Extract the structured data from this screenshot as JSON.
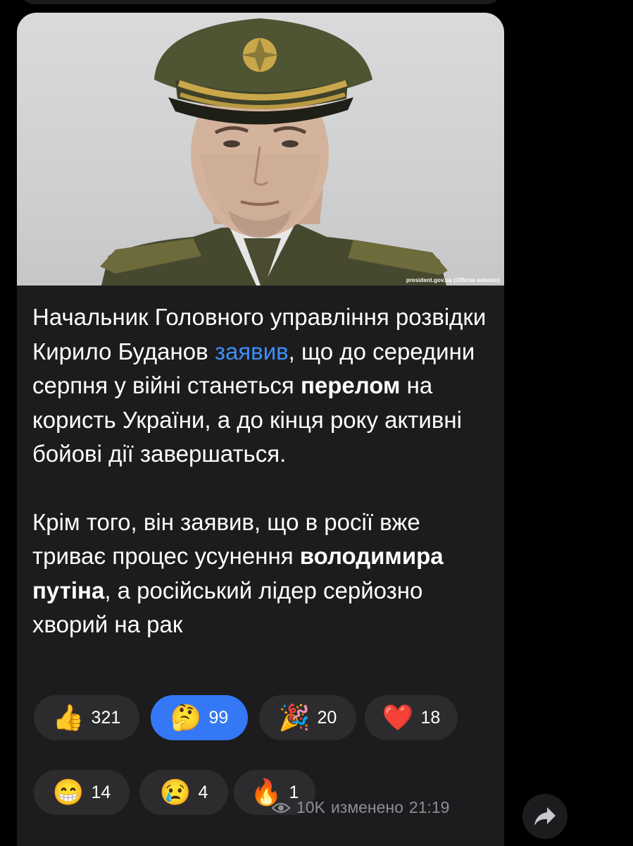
{
  "message": {
    "image_credit": "president.gov.ua (Official website)",
    "paragraphs": [
      [
        {
          "text": "Начальник Головного управління розвідки Кирило Буданов ",
          "style": "normal"
        },
        {
          "text": "заявив",
          "style": "link"
        },
        {
          "text": ", що до середини серпня у війні станеться ",
          "style": "normal"
        },
        {
          "text": "перелом",
          "style": "bold"
        },
        {
          "text": " на користь України, а до кінця року активні бойові дії завершаться.",
          "style": "normal"
        }
      ],
      [
        {
          "text": "Крім того, він заявив, що в росії вже триває процес усунення ",
          "style": "normal"
        },
        {
          "text": "володимира путіна",
          "style": "bold"
        },
        {
          "text": ", а російський лідер серйозно хворий на рак",
          "style": "normal"
        }
      ]
    ],
    "reactions": [
      {
        "emoji": "👍",
        "icon": "thumbs-up",
        "count": "321",
        "active": false
      },
      {
        "emoji": "🤔",
        "icon": "thinking-face",
        "count": "99",
        "active": true
      },
      {
        "emoji": "🎉",
        "icon": "party-popper",
        "count": "20",
        "active": false
      },
      {
        "emoji": "❤️",
        "icon": "red-heart",
        "count": "18",
        "active": false
      },
      {
        "emoji": "😁",
        "icon": "grinning-face",
        "count": "14",
        "active": false
      },
      {
        "emoji": "😢",
        "icon": "crying-face",
        "count": "4",
        "active": false
      },
      {
        "emoji": "🔥",
        "icon": "fire",
        "count": "1",
        "active": false
      }
    ],
    "footer": {
      "views": "10K",
      "edited_label": "изменено",
      "time": "21:19"
    }
  },
  "colors": {
    "background": "#000000",
    "bubble": "#1c1c1e",
    "pill": "#2c2c2e",
    "pill_active": "#3478f6",
    "link": "#3e8ef7",
    "meta_text": "#8e8e93"
  },
  "icons": {
    "views": "eye-icon",
    "share": "share-arrow-icon"
  }
}
